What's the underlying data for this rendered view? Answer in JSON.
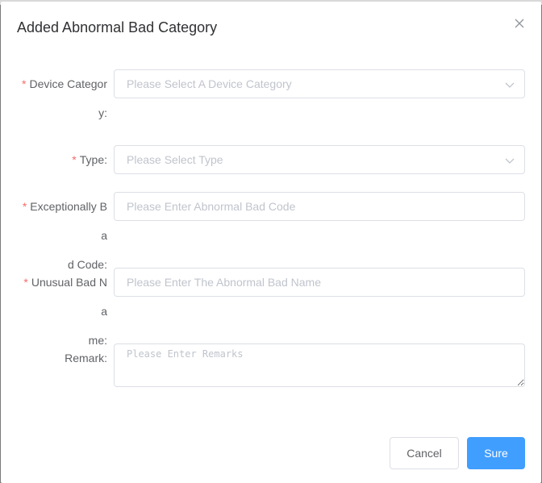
{
  "dialog": {
    "title": "Added Abnormal Bad Category",
    "close_icon": "close-icon"
  },
  "form": {
    "required_mark": "*",
    "device_category": {
      "label_line1": "Device Categor",
      "label_line2": "y:",
      "placeholder": "Please Select A Device Category",
      "icon": "chevron-down-icon"
    },
    "type": {
      "label": "Type:",
      "placeholder": "Please Select Type",
      "icon": "chevron-down-icon"
    },
    "bad_code": {
      "label_line1": "Exceptionally Ba",
      "label_line2": "d Code:",
      "placeholder": "Please Enter Abnormal Bad Code"
    },
    "bad_name": {
      "label_line1": "Unusual Bad Na",
      "label_line2": "me:",
      "placeholder": "Please Enter The Abnormal Bad Name"
    },
    "remark": {
      "label": "Remark:",
      "placeholder": "Please Enter Remarks"
    }
  },
  "footer": {
    "cancel_label": "Cancel",
    "sure_label": "Sure"
  },
  "colors": {
    "primary": "#409eff",
    "required": "#f56c6c",
    "placeholder": "#c0c4cc",
    "border": "#dcdfe6"
  }
}
